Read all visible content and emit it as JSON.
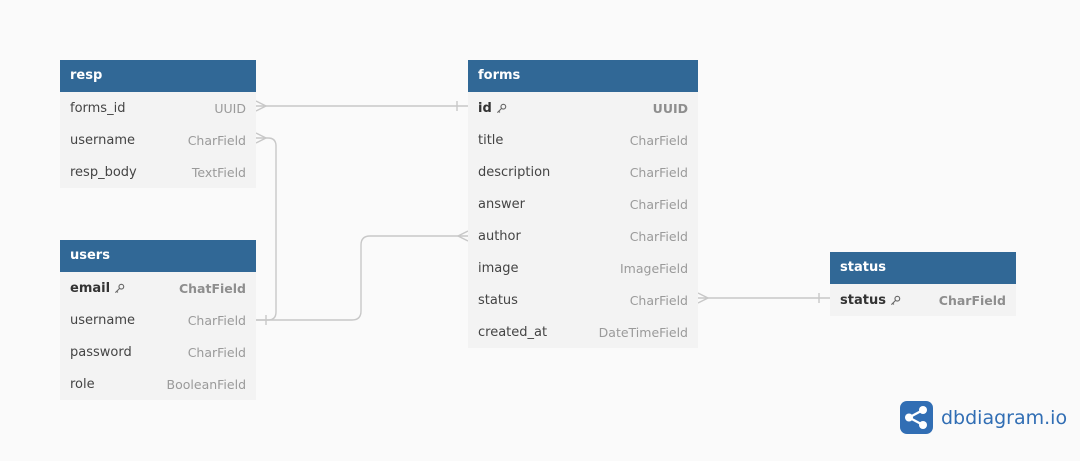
{
  "tables": [
    {
      "id": "resp",
      "name": "resp",
      "fields": [
        {
          "name": "forms_id",
          "type": "UUID",
          "pk": false
        },
        {
          "name": "username",
          "type": "CharField",
          "pk": false
        },
        {
          "name": "resp_body",
          "type": "TextField",
          "pk": false
        }
      ]
    },
    {
      "id": "users",
      "name": "users",
      "fields": [
        {
          "name": "email",
          "type": "ChatField",
          "pk": true
        },
        {
          "name": "username",
          "type": "CharField",
          "pk": false
        },
        {
          "name": "password",
          "type": "CharField",
          "pk": false
        },
        {
          "name": "role",
          "type": "BooleanField",
          "pk": false
        }
      ]
    },
    {
      "id": "forms",
      "name": "forms",
      "fields": [
        {
          "name": "id",
          "type": "UUID",
          "pk": true
        },
        {
          "name": "title",
          "type": "CharField",
          "pk": false
        },
        {
          "name": "description",
          "type": "CharField",
          "pk": false
        },
        {
          "name": "answer",
          "type": "CharField",
          "pk": false
        },
        {
          "name": "author",
          "type": "CharField",
          "pk": false
        },
        {
          "name": "image",
          "type": "ImageField",
          "pk": false
        },
        {
          "name": "status",
          "type": "CharField",
          "pk": false
        },
        {
          "name": "created_at",
          "type": "DateTimeField",
          "pk": false
        }
      ]
    },
    {
      "id": "status",
      "name": "status",
      "fields": [
        {
          "name": "status",
          "type": "CharField",
          "pk": true
        }
      ]
    }
  ],
  "relations": [
    {
      "from_table": "resp",
      "from_field": "forms_id",
      "to_table": "forms",
      "to_field": "id"
    },
    {
      "from_table": "resp",
      "from_field": "username",
      "to_table": "users",
      "to_field": "username"
    },
    {
      "from_table": "forms",
      "from_field": "author",
      "to_table": "users",
      "to_field": "username"
    },
    {
      "from_table": "forms",
      "from_field": "status",
      "to_table": "status",
      "to_field": "status"
    }
  ],
  "colors": {
    "header": "#316896",
    "body": "#f3f3f3",
    "link": "#c8c8c8",
    "logo": "#316eb4"
  },
  "branding": {
    "logo_text": "dbdiagram.io",
    "logo_icon": "share-nodes-icon"
  }
}
